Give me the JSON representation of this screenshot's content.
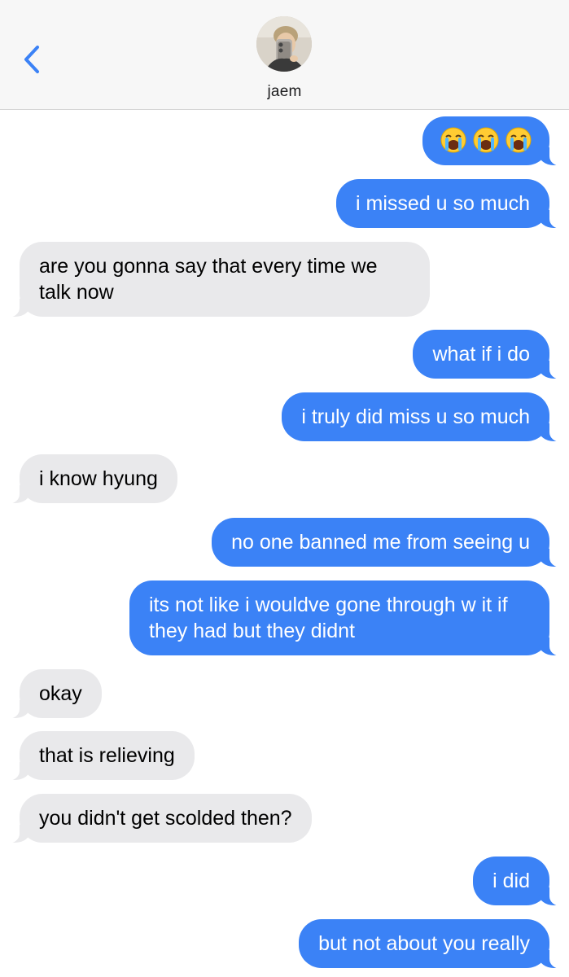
{
  "header": {
    "contact_name": "jaem",
    "back_icon": "chevron-left-icon",
    "accent_color": "#3b82f6"
  },
  "messages": [
    {
      "direction": "out",
      "text": "😭😭😭",
      "emoji": [
        "loudly-crying-face",
        "loudly-crying-face",
        "loudly-crying-face"
      ]
    },
    {
      "direction": "out",
      "text": "i missed u so much"
    },
    {
      "direction": "in",
      "text": "are you gonna say that every time we talk now"
    },
    {
      "direction": "out",
      "text": "what if i do"
    },
    {
      "direction": "out",
      "text": "i truly did miss u so much"
    },
    {
      "direction": "in",
      "text": "i know hyung"
    },
    {
      "direction": "out",
      "text": "no one banned me from seeing u"
    },
    {
      "direction": "out",
      "text": "its not like i wouldve gone through w it if they had but they didnt"
    },
    {
      "direction": "in",
      "text": "okay"
    },
    {
      "direction": "in",
      "text": "that is relieving"
    },
    {
      "direction": "in",
      "text": "you didn't get scolded then?"
    },
    {
      "direction": "out",
      "text": "i did"
    },
    {
      "direction": "out",
      "text": "but not about you really"
    }
  ],
  "colors": {
    "outgoing_bubble": "#3b82f6",
    "incoming_bubble": "#e9e9eb",
    "header_bg": "#f7f7f7"
  }
}
